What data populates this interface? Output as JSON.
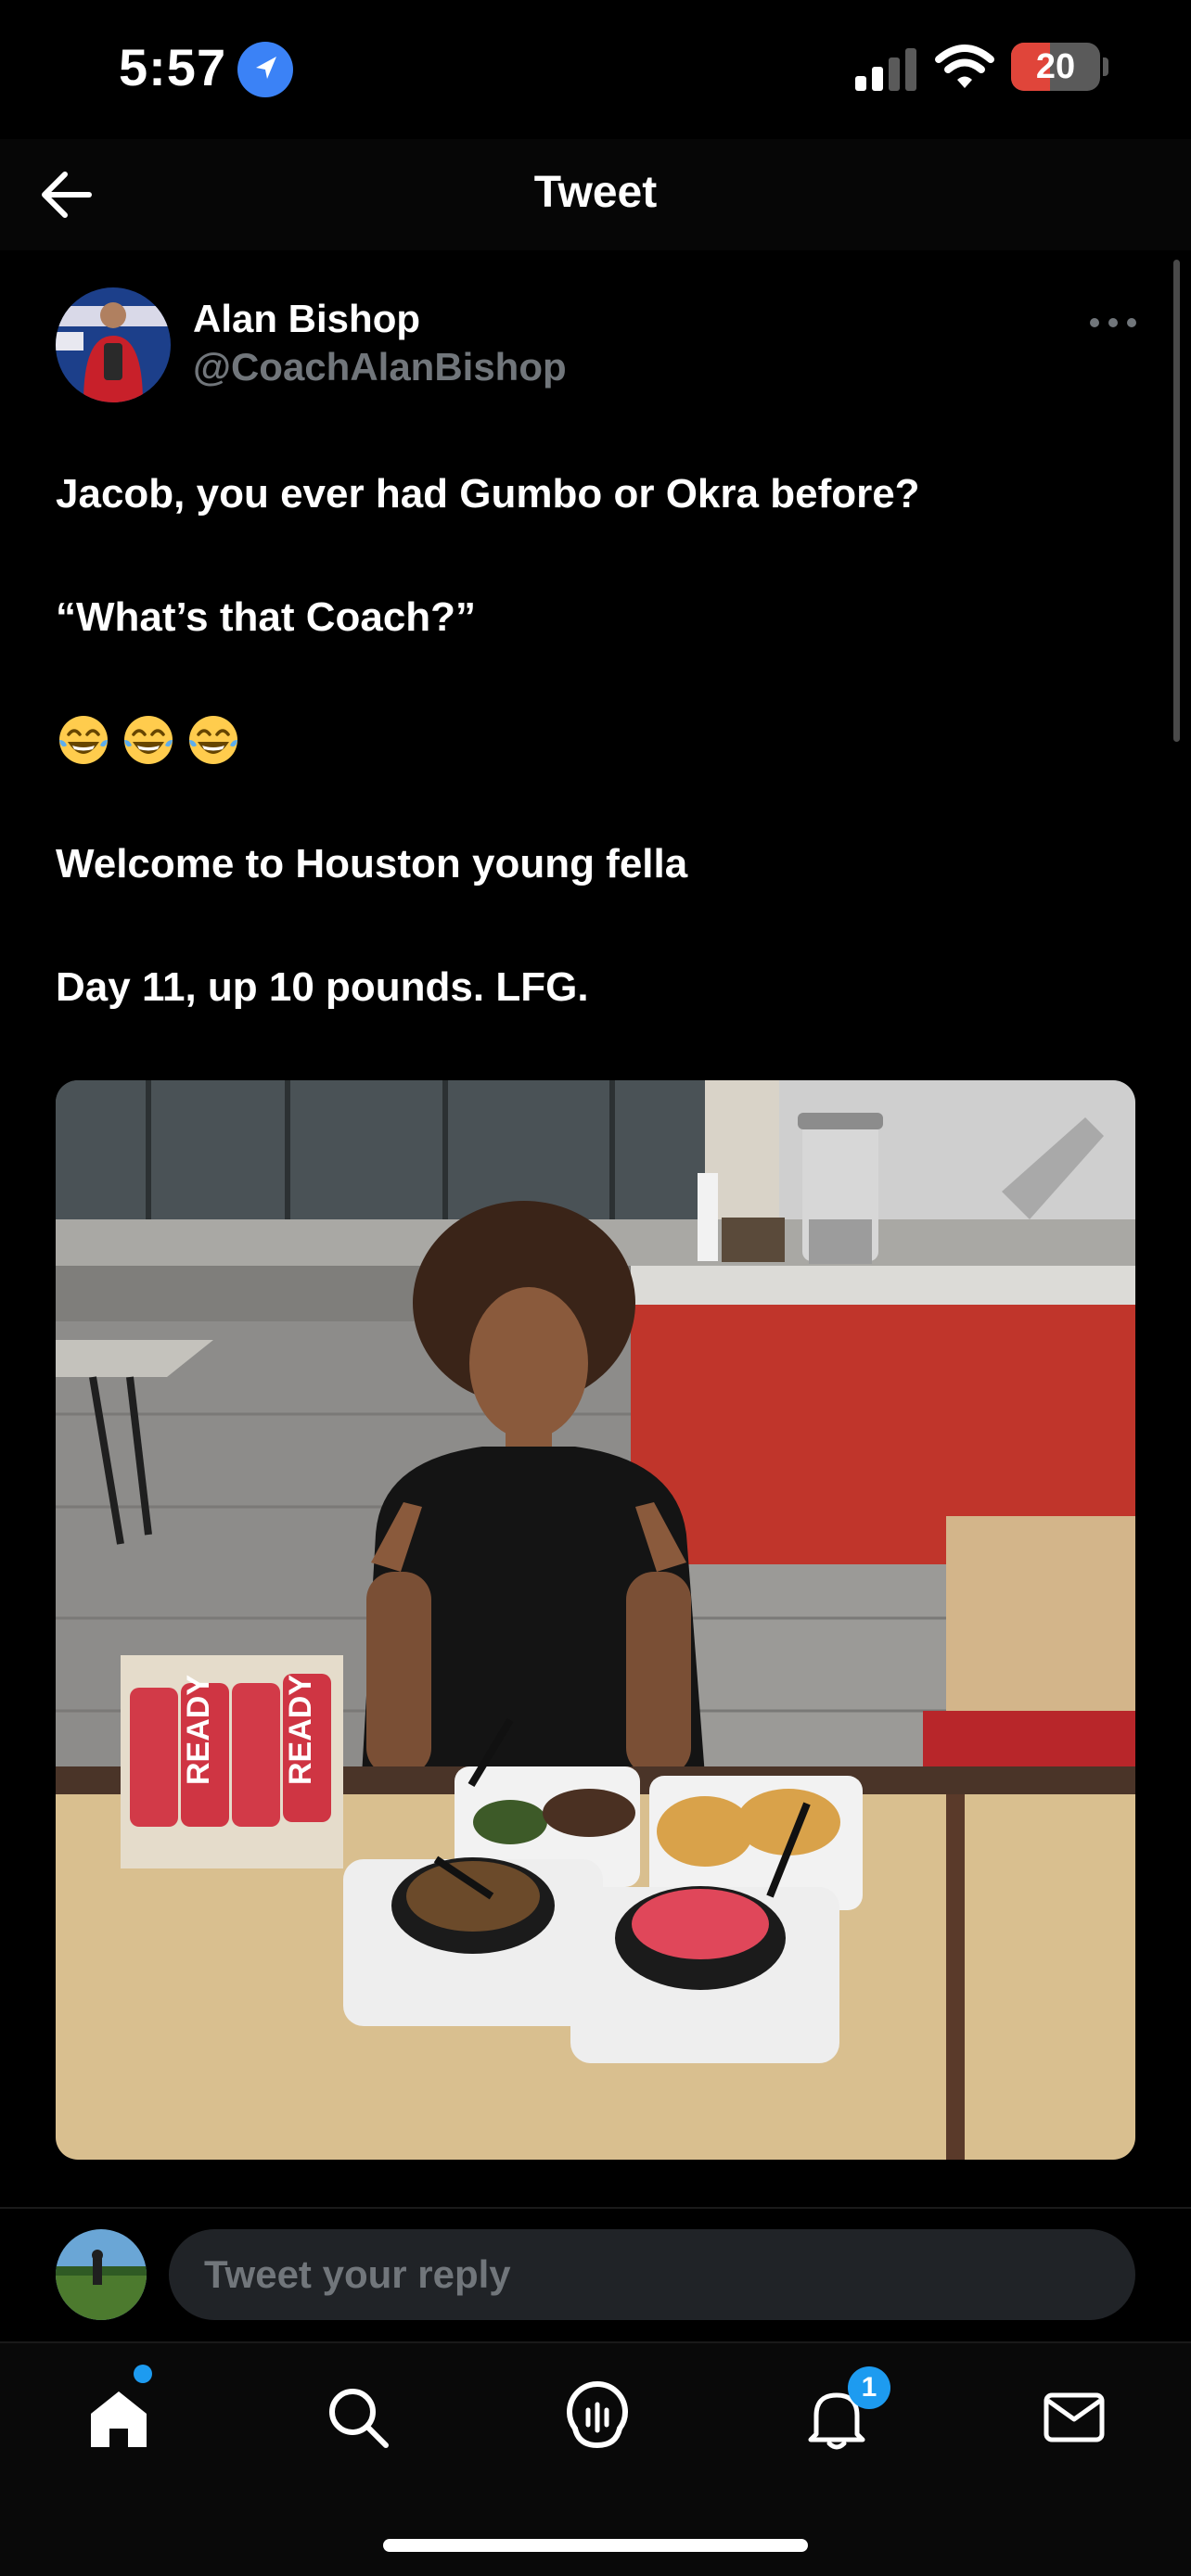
{
  "status_bar": {
    "time": "5:57",
    "battery_level": "20",
    "icons": [
      "location-arrow-icon",
      "cellular-signal-icon",
      "wifi-icon",
      "battery-icon"
    ]
  },
  "header": {
    "title": "Tweet",
    "back_icon": "arrow-left-icon"
  },
  "tweet": {
    "author": {
      "name": "Alan Bishop",
      "handle": "@CoachAlanBishop"
    },
    "more_icon": "more-horizontal-icon",
    "lines": [
      "Jacob, you ever had Gumbo or Okra before?",
      "“What’s that Coach?”",
      "Welcome to Houston young fella",
      "Day 11, up 10 pounds. LFG."
    ],
    "emojis": [
      "😂",
      "😂",
      "😂"
    ],
    "photo_bottle_label": "READY"
  },
  "reply": {
    "placeholder": "Tweet your reply"
  },
  "tab_bar": {
    "items": [
      {
        "name": "home",
        "icon": "home-icon"
      },
      {
        "name": "search",
        "icon": "search-icon"
      },
      {
        "name": "spaces",
        "icon": "spaces-icon"
      },
      {
        "name": "notifications",
        "icon": "bell-icon"
      },
      {
        "name": "messages",
        "icon": "mail-icon"
      }
    ],
    "notifications_count": "1"
  },
  "colors": {
    "background": "#000000",
    "text": "#ffffff",
    "muted": "#71767b",
    "accent": "#1d9bf0",
    "battery_low": "#e0453a"
  }
}
